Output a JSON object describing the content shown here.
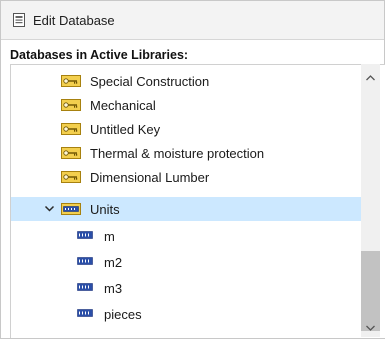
{
  "window": {
    "title": "Edit Database",
    "title_icon": "database-icon"
  },
  "section": {
    "label": "Databases in Active Libraries:"
  },
  "tree": {
    "items": [
      {
        "label": "Special Construction",
        "icon": "key-icon",
        "level": 1,
        "expanded": null,
        "selected": false
      },
      {
        "label": "Mechanical",
        "icon": "key-icon",
        "level": 1,
        "expanded": null,
        "selected": false
      },
      {
        "label": "Untitled Key",
        "icon": "key-icon",
        "level": 1,
        "expanded": null,
        "selected": false
      },
      {
        "label": "Thermal & moisture protection",
        "icon": "key-icon",
        "level": 1,
        "expanded": null,
        "selected": false
      },
      {
        "label": "Dimensional Lumber",
        "icon": "key-icon",
        "level": 1,
        "expanded": null,
        "selected": false
      },
      {
        "label": "Units",
        "icon": "units-folder-icon",
        "level": 1,
        "expanded": true,
        "selected": true
      },
      {
        "label": "m",
        "icon": "unit-icon",
        "level": 2,
        "expanded": null,
        "selected": false
      },
      {
        "label": "m2",
        "icon": "unit-icon",
        "level": 2,
        "expanded": null,
        "selected": false
      },
      {
        "label": "m3",
        "icon": "unit-icon",
        "level": 2,
        "expanded": null,
        "selected": false
      },
      {
        "label": "pieces",
        "icon": "unit-icon",
        "level": 2,
        "expanded": null,
        "selected": false
      }
    ]
  },
  "scrollbar": {
    "up_arrow_icon": "chevron-up-icon",
    "down_arrow_icon": "chevron-down-icon"
  },
  "colors": {
    "selection": "#cce8ff",
    "key_icon": "#d4a017",
    "unit_icon": "#2b4fa8"
  }
}
